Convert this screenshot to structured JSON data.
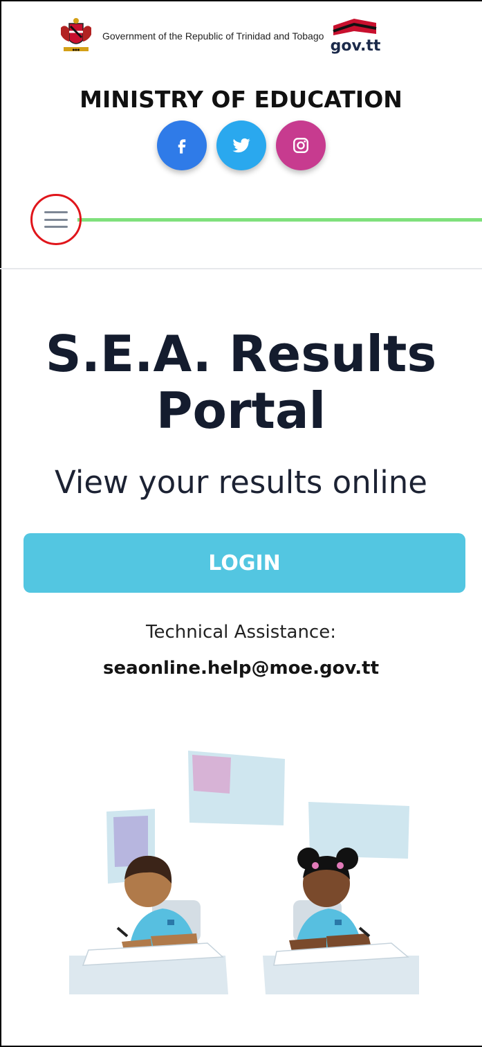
{
  "header": {
    "gov_text": "Government of the Republic of Trinidad and Tobago",
    "govtt_logo_text": "gov.tt",
    "ministry": "MINISTRY OF EDUCATION"
  },
  "social": [
    {
      "name": "facebook",
      "icon": "facebook-icon",
      "color": "#2f7be8"
    },
    {
      "name": "twitter",
      "icon": "twitter-icon",
      "color": "#2aa8ee"
    },
    {
      "name": "instagram",
      "icon": "instagram-icon",
      "color": "#c73b8f"
    }
  ],
  "nav": {
    "menu_icon": "hamburger-menu-icon",
    "accent_line_color": "#7fe07c"
  },
  "hero": {
    "title_line1": "S.E.A. Results",
    "title_line2": "Portal",
    "subtitle": "View your results online",
    "login_label": "LOGIN",
    "login_color": "#53c6e1"
  },
  "support": {
    "label": "Technical Assistance:",
    "email": "seaonline.help@moe.gov.tt"
  }
}
